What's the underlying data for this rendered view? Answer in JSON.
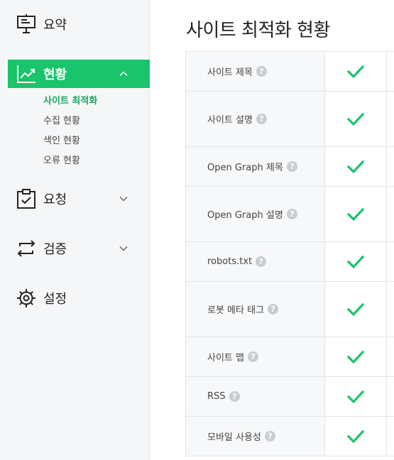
{
  "sidebar": {
    "items": [
      {
        "label": "요약",
        "icon": "presentation-board-icon"
      },
      {
        "label": "현황",
        "icon": "trend-chart-icon",
        "active": true
      },
      {
        "label": "요청",
        "icon": "clipboard-check-icon"
      },
      {
        "label": "검증",
        "icon": "repeat-arrows-icon"
      },
      {
        "label": "설정",
        "icon": "gear-icon"
      }
    ],
    "sub_items": [
      {
        "label": "사이트 최적화",
        "active": true
      },
      {
        "label": "수집 현황"
      },
      {
        "label": "색인 현황"
      },
      {
        "label": "오류 현황"
      }
    ]
  },
  "main": {
    "title": "사이트 최적화 현황",
    "rows": [
      {
        "label": "사이트 제목",
        "status": "pass"
      },
      {
        "label": "사이트 설명",
        "status": "pass"
      },
      {
        "label": "Open Graph 제목",
        "status": "pass"
      },
      {
        "label": "Open Graph 설명",
        "status": "pass"
      },
      {
        "label": "robots.txt",
        "status": "pass"
      },
      {
        "label": "로봇 메타 태그",
        "status": "pass"
      },
      {
        "label": "사이트 맵",
        "status": "pass"
      },
      {
        "label": "RSS",
        "status": "pass"
      },
      {
        "label": "모바일 사용성",
        "status": "pass"
      }
    ],
    "help_glyph": "?"
  },
  "colors": {
    "accent": "#19c46b",
    "active_sub": "#18a85a",
    "sidebar_bg": "#f5f6f8",
    "row_label_bg": "#f7f8fa",
    "help_bg": "#c9ccd1"
  }
}
